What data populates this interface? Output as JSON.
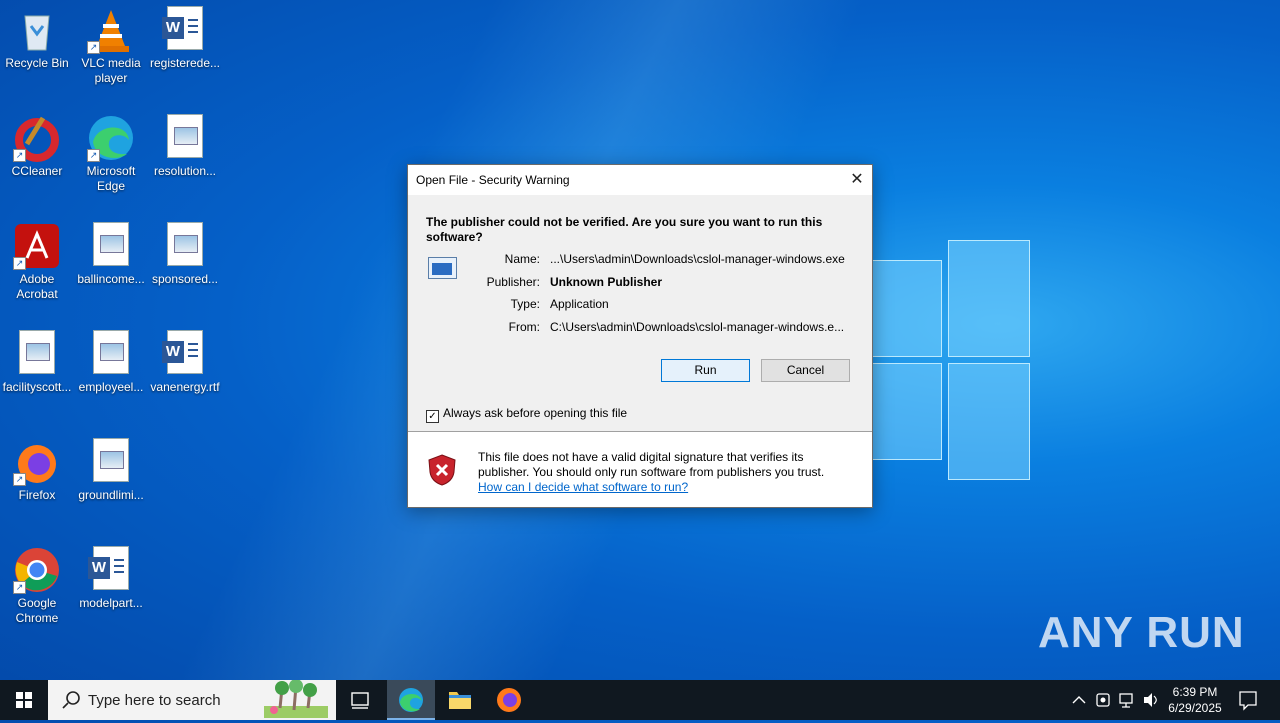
{
  "desktop": {
    "icons": [
      {
        "label": "Recycle Bin"
      },
      {
        "label": "VLC media player"
      },
      {
        "label": "registerede..."
      },
      {
        "label": "CCleaner"
      },
      {
        "label": "Microsoft Edge"
      },
      {
        "label": "resolution..."
      },
      {
        "label": "Adobe Acrobat"
      },
      {
        "label": "ballincome..."
      },
      {
        "label": "sponsored..."
      },
      {
        "label": "facilityscott..."
      },
      {
        "label": "employeel..."
      },
      {
        "label": "vanenergy.rtf"
      },
      {
        "label": "Firefox"
      },
      {
        "label": "groundlimi..."
      },
      {
        "label": "Google Chrome"
      },
      {
        "label": "modelpart..."
      }
    ]
  },
  "dialog": {
    "title": "Open File - Security Warning",
    "heading": "The publisher could not be verified.  Are you sure you want to run this software?",
    "fields": [
      {
        "label": "Name:",
        "value": "...\\Users\\admin\\Downloads\\cslol-manager-windows.exe"
      },
      {
        "label": "Publisher:",
        "value": "Unknown Publisher"
      },
      {
        "label": "Type:",
        "value": "Application"
      },
      {
        "label": "From:",
        "value": "C:\\Users\\admin\\Downloads\\cslol-manager-windows.e..."
      }
    ],
    "run_label": "Run",
    "cancel_label": "Cancel",
    "checkbox_label": "Always ask before opening this file",
    "checkbox_checked": true,
    "warning_text": "This file does not have a valid digital signature that verifies its publisher.  You should only run software from publishers you trust.",
    "help_link": "How can I decide what software to run?"
  },
  "taskbar": {
    "search_placeholder": "Type here to search",
    "time": "6:39 PM",
    "date": "6/29/2025"
  },
  "watermark": "ANY RUN"
}
